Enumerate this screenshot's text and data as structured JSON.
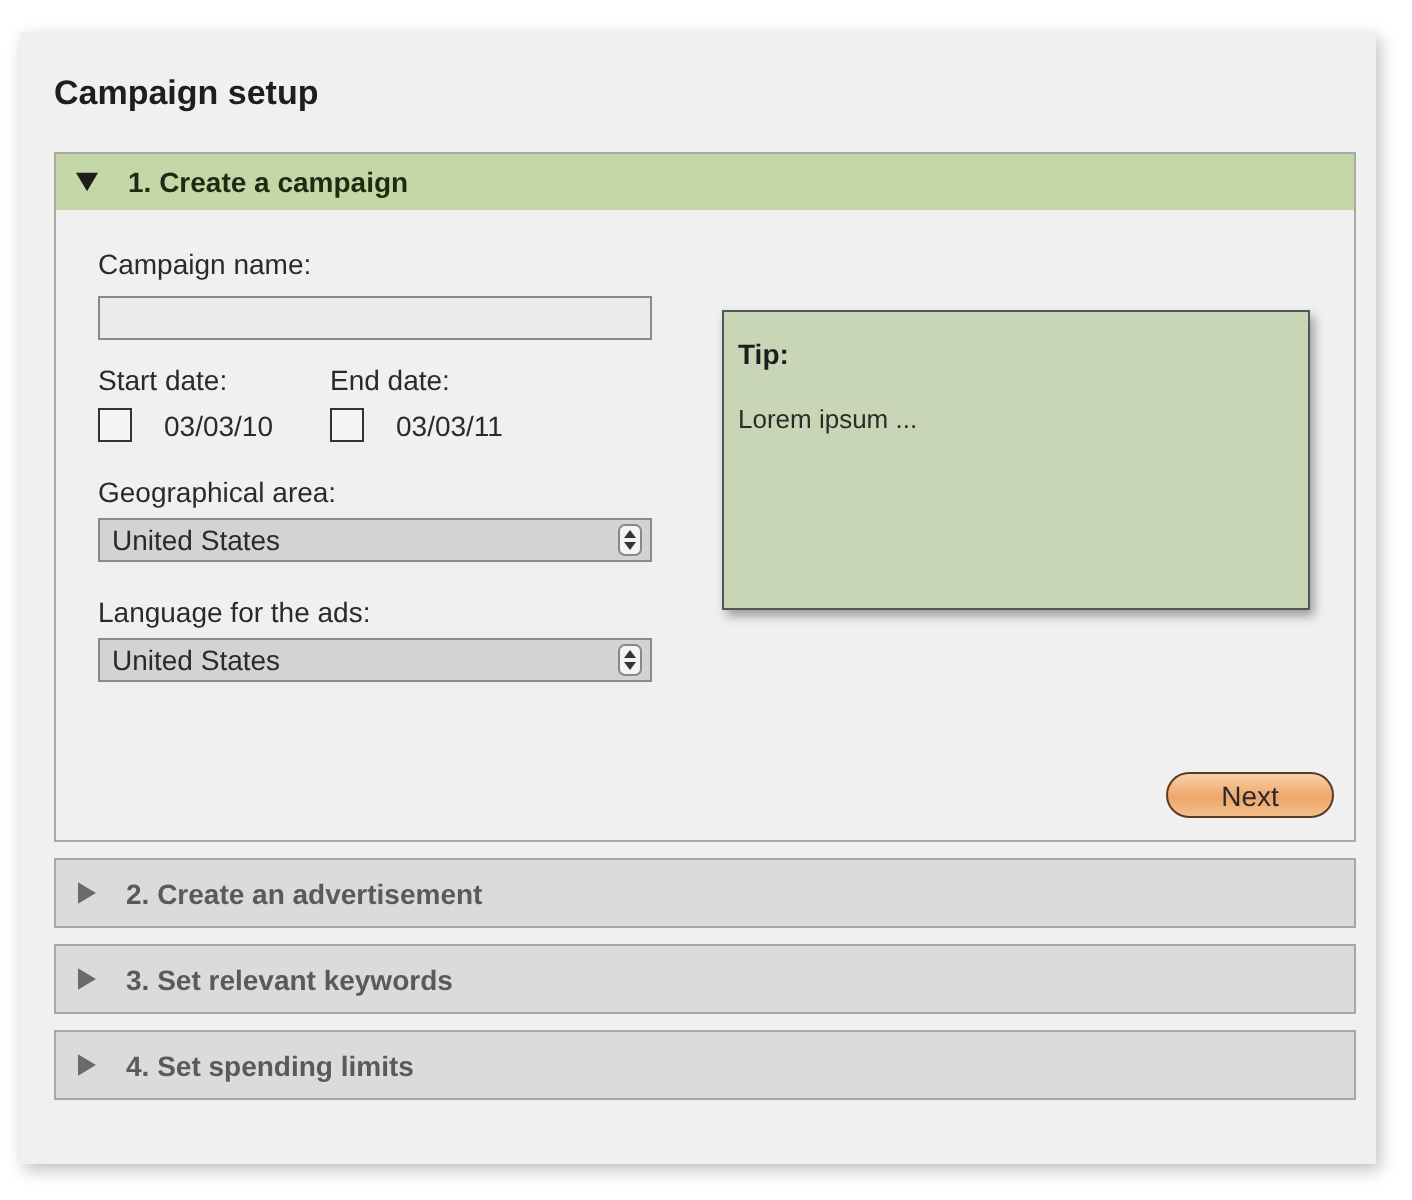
{
  "title": "Campaign setup",
  "sections": [
    {
      "title": "1. Create a campaign",
      "expanded": true,
      "content": {
        "name_field": {
          "label": "Campaign name:"
        },
        "dates": [
          {
            "label": "Start date:",
            "value": "03/03/10",
            "checked": false
          },
          {
            "label": "End date:",
            "value": "03/03/11",
            "checked": false
          }
        ],
        "selects": [
          {
            "label": "Geographical area:",
            "value": "United States"
          },
          {
            "label": "Language for the ads:",
            "value": "United States"
          }
        ],
        "tip": {
          "title": "Tip:",
          "text": "Lorem ipsum ..."
        },
        "next_button": "Next"
      }
    },
    {
      "title": "2. Create an advertisement",
      "expanded": false
    },
    {
      "title": "3. Set relevant keywords",
      "expanded": false
    },
    {
      "title": "4. Set spending limits",
      "expanded": false
    }
  ]
}
